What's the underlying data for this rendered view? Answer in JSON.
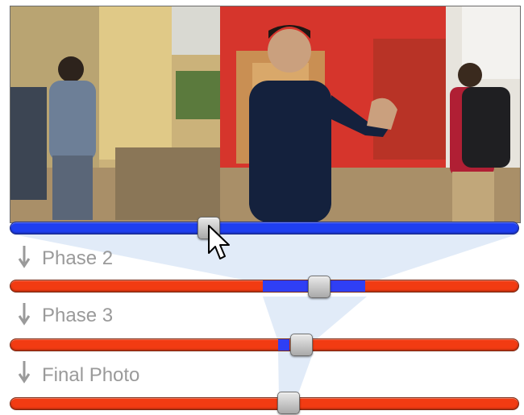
{
  "stages": [
    {
      "label": "",
      "fill": "blue",
      "thumb_position": 0.39
    },
    {
      "label": "Phase 2",
      "fill": "red",
      "selected_range": [
        0.497,
        0.696
      ],
      "thumb_position": 0.608
    },
    {
      "label": "Phase 3",
      "fill": "red",
      "selected_range": [
        0.527,
        0.548
      ],
      "thumb_position": 0.572
    },
    {
      "label": "Final Photo",
      "fill": "red",
      "thumb_position": 0.548
    }
  ],
  "colors": {
    "track_red": "#f23b12",
    "track_blue": "#1f3ff0",
    "label_gray": "#9a9a9a",
    "funnel": "#c9daf2"
  },
  "icons": [
    "down-arrow-icon",
    "mouse-cursor-icon"
  ]
}
